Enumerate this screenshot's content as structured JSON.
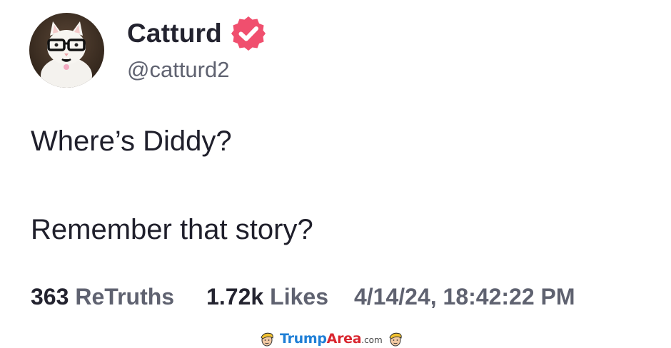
{
  "author": {
    "display_name": "Catturd",
    "handle": "@catturd2",
    "verified": true,
    "badge_color": "#f04f6e"
  },
  "post": {
    "lines": [
      "Where’s Diddy?",
      "Remember that story?"
    ]
  },
  "stats": {
    "retruths_count": "363",
    "retruths_label": "ReTruths",
    "likes_count": "1.72k",
    "likes_label": "Likes",
    "timestamp": "4/14/24, 18:42:22 PM"
  },
  "watermark": {
    "part1": "Trump",
    "part2": "Area",
    "part3": ".com",
    "color1": "#1f7fd6",
    "color2": "#d9262f"
  }
}
